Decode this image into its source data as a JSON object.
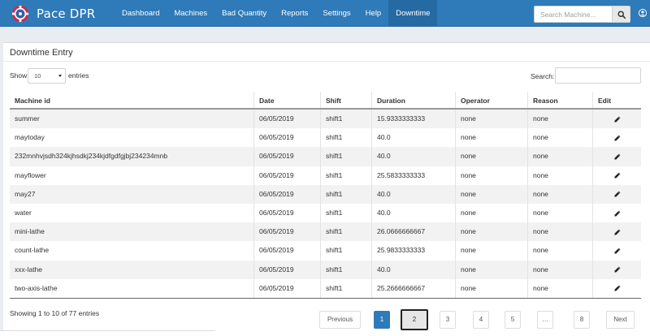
{
  "app": {
    "name": "Pace DPR"
  },
  "nav": {
    "items": [
      {
        "label": "Dashboard"
      },
      {
        "label": "Machines"
      },
      {
        "label": "Bad Quantity"
      },
      {
        "label": "Reports"
      },
      {
        "label": "Settings"
      },
      {
        "label": "Help"
      },
      {
        "label": "Downtime",
        "active": true
      }
    ]
  },
  "search": {
    "placeholder": "Search Machine..."
  },
  "panel": {
    "title": "Downtime Entry",
    "show_label": "Show",
    "page_size": "10",
    "entries_label": "entries",
    "search_label": "Search:"
  },
  "table": {
    "columns": [
      "Machine id",
      "Date",
      "Shift",
      "Duration",
      "Operator",
      "Reason",
      "Edit"
    ],
    "rows": [
      [
        "summer",
        "06/05/2019",
        "shift1",
        "15.9333333333",
        "none",
        "none"
      ],
      [
        "maytoday",
        "06/05/2019",
        "shift1",
        "40.0",
        "none",
        "none"
      ],
      [
        "232mnhvjsdh324kjhsdkj234kjdfgdfgjbj234234mnb",
        "06/05/2019",
        "shift1",
        "40.0",
        "none",
        "none"
      ],
      [
        "mayflower",
        "06/05/2019",
        "shift1",
        "25.5833333333",
        "none",
        "none"
      ],
      [
        "may27",
        "06/05/2019",
        "shift1",
        "40.0",
        "none",
        "none"
      ],
      [
        "water",
        "06/05/2019",
        "shift1",
        "40.0",
        "none",
        "none"
      ],
      [
        "mini-lathe",
        "06/05/2019",
        "shift1",
        "26.0666666667",
        "none",
        "none"
      ],
      [
        "count-lathe",
        "06/05/2019",
        "shift1",
        "25.9833333333",
        "none",
        "none"
      ],
      [
        "xxx-lathe",
        "06/05/2019",
        "shift1",
        "40.0",
        "none",
        "none"
      ],
      [
        "two-axis-lathe",
        "06/05/2019",
        "shift1",
        "25.2666666667",
        "none",
        "none"
      ]
    ],
    "edit_icon": "pencil-icon"
  },
  "info": "Showing 1 to 10 of 77 entries",
  "pagination": {
    "previous": "Previous",
    "pages": [
      "1",
      "2",
      "3",
      "4",
      "5",
      "…",
      "8"
    ],
    "active_page": "1",
    "focused_page": "2",
    "next": "Next"
  },
  "colors": {
    "nav_bg": "#2f7ab8",
    "accent": "#2f7ab8"
  }
}
